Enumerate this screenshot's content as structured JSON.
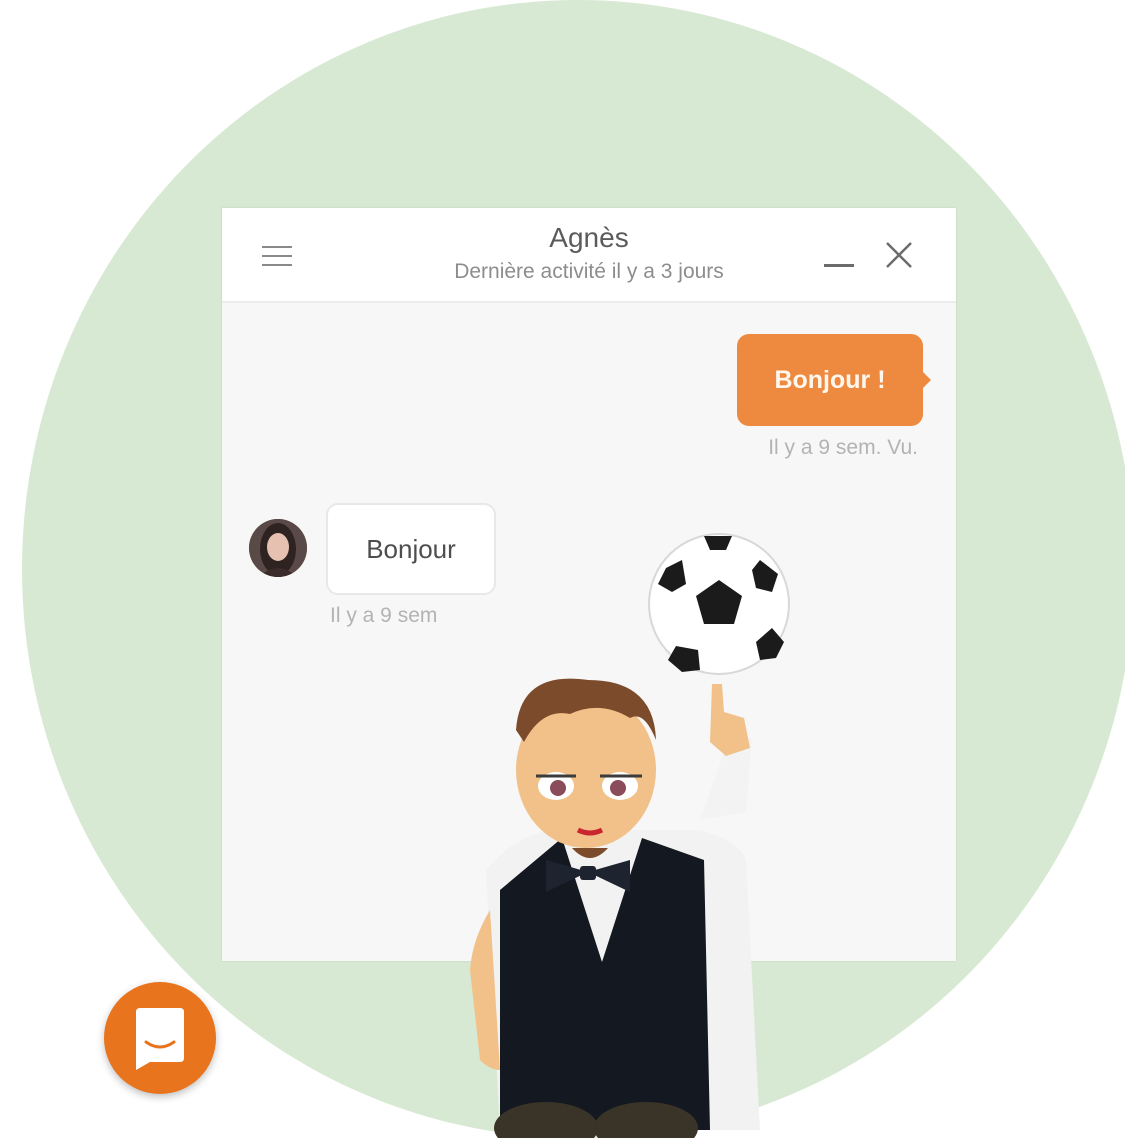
{
  "chat": {
    "contact_name": "Agnès",
    "status": "Dernière activité il y a 3 jours",
    "messages": [
      {
        "direction": "outgoing",
        "text": "Bonjour !",
        "meta": "Il y a 9 sem. Vu."
      },
      {
        "direction": "incoming",
        "text": "Bonjour",
        "meta": "Il y a 9 sem"
      }
    ]
  },
  "icons": {
    "menu": "hamburger-menu-icon",
    "minimize": "minimize-icon",
    "close": "close-icon",
    "launcher": "chat-bubble-icon"
  },
  "colors": {
    "accent": "#ee8a3f",
    "launcher": "#e8741d",
    "background_circle": "#d8e9d3",
    "chat_background": "#f7f7f7"
  }
}
